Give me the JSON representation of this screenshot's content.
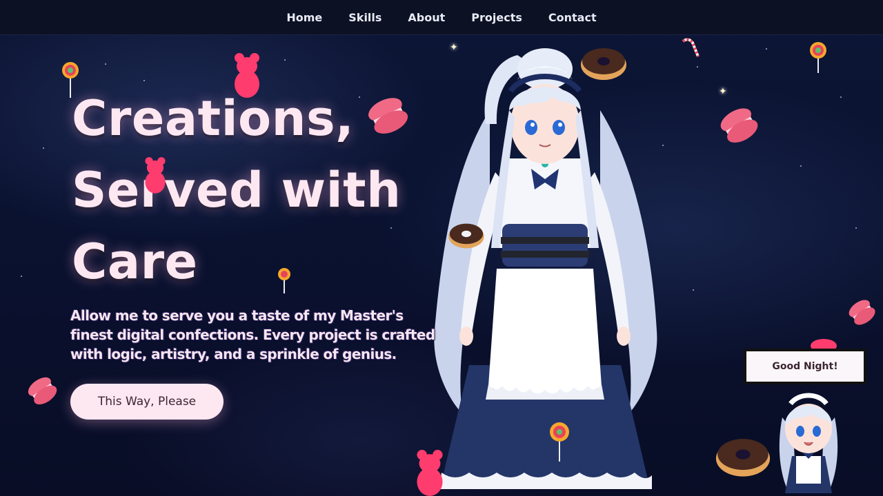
{
  "nav": {
    "items": [
      {
        "label": "Home"
      },
      {
        "label": "Skills"
      },
      {
        "label": "About"
      },
      {
        "label": "Projects"
      },
      {
        "label": "Contact"
      }
    ]
  },
  "hero": {
    "title_lines": [
      "Creations,",
      "Served with",
      "Care"
    ],
    "subtitle": "Allow me to serve you a taste of my Master's finest digital confections. Every project is crafted with logic, artistry, and a sprinkle of genius.",
    "cta_label": "This Way, Please"
  },
  "assistant": {
    "speech": "Good Night!"
  },
  "decorations": {
    "icons": [
      "lollipop-icon",
      "gummy-bear-icon",
      "macaron-icon",
      "donut-icon",
      "candy-cane-icon",
      "sparkle-icon"
    ]
  },
  "colors": {
    "background": "#0a1230",
    "title": "#fde8f2",
    "button": "#fde8f2",
    "macaron": "#f06a86",
    "gummy": "#ff3c6e",
    "maid_dress": "#243568"
  }
}
